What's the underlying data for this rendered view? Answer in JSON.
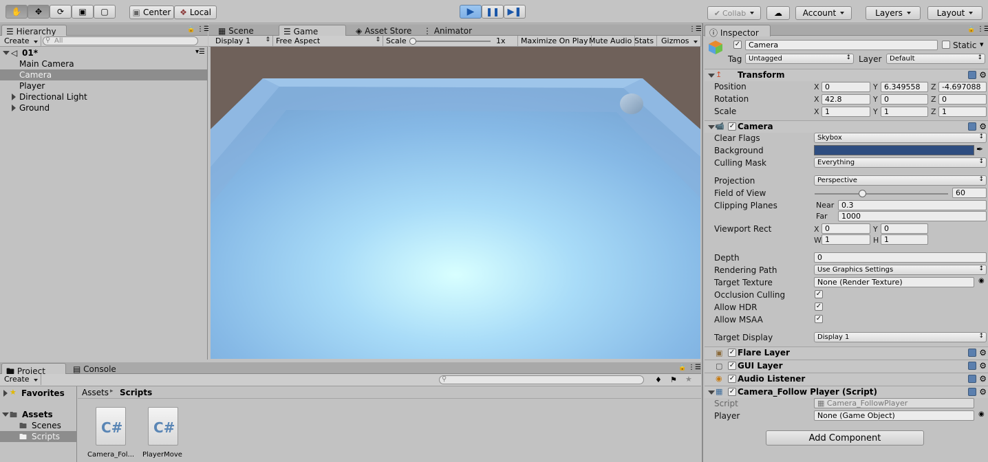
{
  "toolbar": {
    "pivot": "Center",
    "space": "Local",
    "collab": "Collab",
    "account": "Account",
    "layers": "Layers",
    "layout": "Layout"
  },
  "hierarchy": {
    "tab": "Hierarchy",
    "create": "Create",
    "search_placeholder": "All",
    "scene": "01*",
    "items": [
      "Main Camera",
      "Camera",
      "Player",
      "Directional Light",
      "Ground"
    ],
    "selected_index": 1
  },
  "game": {
    "tabs": [
      "Scene",
      "Game",
      "Asset Store",
      "Animator"
    ],
    "active_tab": "Game",
    "display": "Display 1",
    "aspect": "Free Aspect",
    "scale_label": "Scale",
    "scale_value": "1x",
    "buttons": [
      "Maximize On Play",
      "Mute Audio",
      "Stats",
      "Gizmos"
    ]
  },
  "project": {
    "tabs": [
      "Project",
      "Console"
    ],
    "create": "Create",
    "favorites": "Favorites",
    "assets": "Assets",
    "folders": [
      "Scenes",
      "Scripts"
    ],
    "breadcrumb": [
      "Assets",
      "Scripts"
    ],
    "files": [
      "Camera_Fol...",
      "PlayerMove"
    ]
  },
  "inspector": {
    "tab": "Inspector",
    "object_name": "Camera",
    "static_label": "Static",
    "tag_label": "Tag",
    "tag_value": "Untagged",
    "layer_label": "Layer",
    "layer_value": "Default",
    "transform": {
      "title": "Transform",
      "position_label": "Position",
      "position": [
        "0",
        "6.349558",
        "-4.697088"
      ],
      "rotation_label": "Rotation",
      "rotation": [
        "42.8",
        "0",
        "0"
      ],
      "scale_label": "Scale",
      "scale": [
        "1",
        "1",
        "1"
      ]
    },
    "camera": {
      "title": "Camera",
      "clear_flags_label": "Clear Flags",
      "clear_flags": "Skybox",
      "background_label": "Background",
      "background_color": "#2e4d80",
      "culling_mask_label": "Culling Mask",
      "culling_mask": "Everything",
      "projection_label": "Projection",
      "projection": "Perspective",
      "fov_label": "Field of View",
      "fov": "60",
      "fov_fraction": 0.355,
      "clipping_label": "Clipping Planes",
      "near_label": "Near",
      "near": "0.3",
      "far_label": "Far",
      "far": "1000",
      "viewport_label": "Viewport Rect",
      "vx": "0",
      "vy": "0",
      "vw": "1",
      "vh": "1",
      "depth_label": "Depth",
      "depth": "0",
      "rendering_path_label": "Rendering Path",
      "rendering_path": "Use Graphics Settings",
      "target_texture_label": "Target Texture",
      "target_texture": "None (Render Texture)",
      "occlusion_label": "Occlusion Culling",
      "hdr_label": "Allow HDR",
      "msaa_label": "Allow MSAA",
      "target_display_label": "Target Display",
      "target_display": "Display 1"
    },
    "components": [
      "Flare Layer",
      "GUI Layer",
      "Audio Listener",
      "Camera_Follow Player (Script)"
    ],
    "script": {
      "script_label": "Script",
      "script_value": "Camera_FollowPlayer",
      "player_label": "Player",
      "player_value": "None (Game Object)"
    },
    "add_component": "Add Component"
  }
}
